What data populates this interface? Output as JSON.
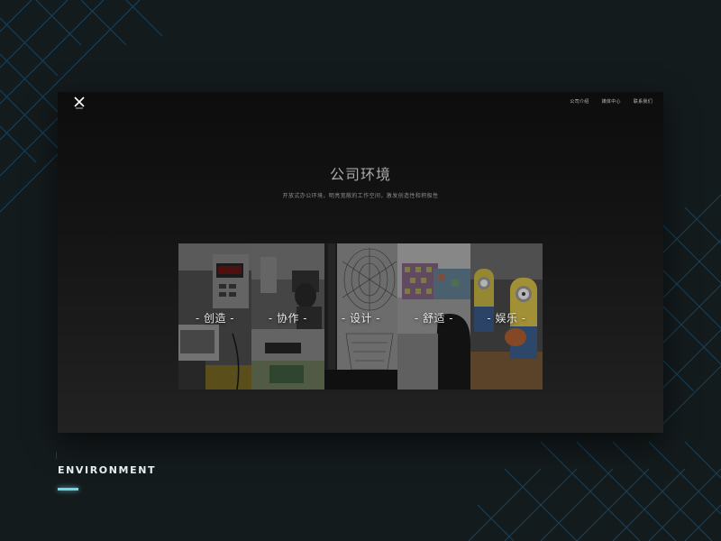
{
  "window": {
    "nav": [
      "公司介绍",
      "媒体中心",
      "联系我们"
    ],
    "title": "公司环境",
    "subtitle": "开放式办公环境，明亮宽敞的工作空间，激发创造性和积极性",
    "panels": [
      {
        "label": "- 创造 -",
        "photo": "electronics-workbench"
      },
      {
        "label": "- 协作 -",
        "photo": "team-at-desks"
      },
      {
        "label": "- 设计 -",
        "photo": "sketch-drawings"
      },
      {
        "label": "- 舒适 -",
        "photo": "cushion-lounge"
      },
      {
        "label": "- 娱乐 -",
        "photo": "minion-toys"
      }
    ]
  },
  "section": {
    "title": "ENVIRONMENT"
  },
  "colors": {
    "accent": "#6fd6e6",
    "background": "#141b1d",
    "pattern": "#1d4a66"
  }
}
